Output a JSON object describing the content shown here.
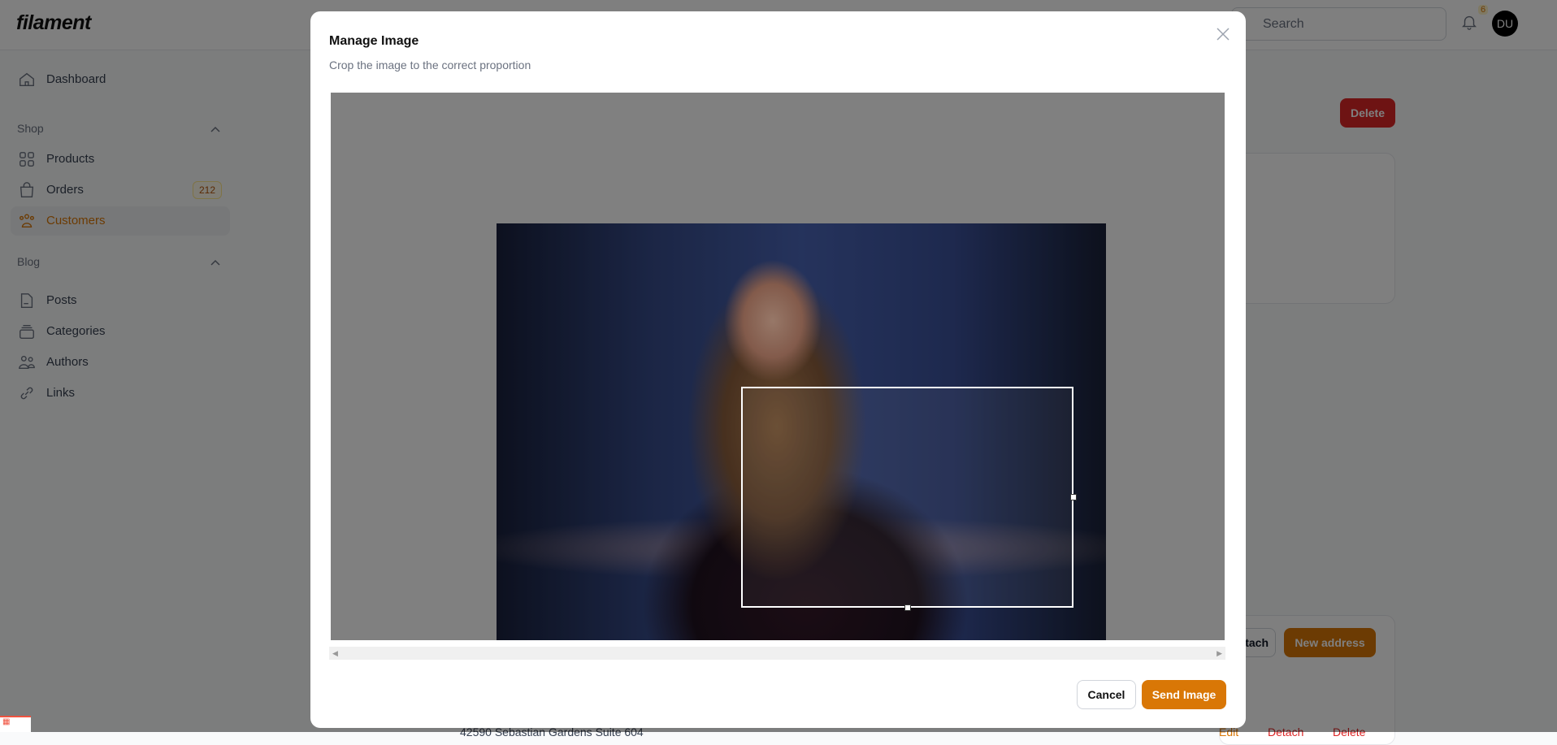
{
  "app": {
    "logo": "filament"
  },
  "topbar": {
    "search_placeholder": "Search",
    "notifications_count": "6",
    "avatar_initials": "DU"
  },
  "sidebar": {
    "dashboard": "Dashboard",
    "groups": [
      {
        "label": "Shop",
        "items": [
          {
            "label": "Products"
          },
          {
            "label": "Orders",
            "badge": "212"
          },
          {
            "label": "Customers",
            "active": true
          }
        ]
      },
      {
        "label": "Blog",
        "items": [
          {
            "label": "Posts"
          },
          {
            "label": "Categories"
          },
          {
            "label": "Authors"
          },
          {
            "label": "Links"
          }
        ]
      }
    ]
  },
  "page": {
    "delete_label": "Delete",
    "attach_label": "Attach",
    "new_address_label": "New address",
    "row": {
      "street": "42590 Sebastian Gardens Suite 604",
      "edit": "Edit",
      "detach": "Detach",
      "delete": "Delete"
    }
  },
  "modal": {
    "title": "Manage Image",
    "subtitle": "Crop the image to the correct proportion",
    "cancel_label": "Cancel",
    "send_label": "Send Image"
  },
  "colors": {
    "primary": "#d97706",
    "danger": "#dc2626"
  }
}
